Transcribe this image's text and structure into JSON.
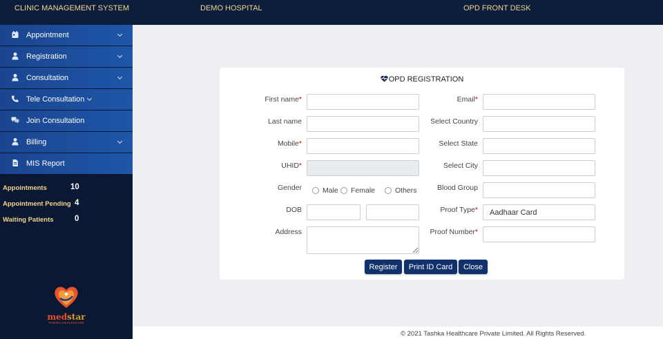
{
  "header": {
    "system_name": "CLINIC MANAGEMENT SYSTEM",
    "hospital_name": "DEMO HOSPITAL",
    "desk_name": "OPD FRONT DESK",
    "text_color": "#f5d58a",
    "background": "#0d1e3d"
  },
  "sidebar": {
    "items": [
      {
        "label": "Appointment",
        "icon": "calendar-icon",
        "has_dropdown": true
      },
      {
        "label": "Registration",
        "icon": "user-icon",
        "has_dropdown": true
      },
      {
        "label": "Consultation",
        "icon": "user-icon",
        "has_dropdown": true
      },
      {
        "label": "Tele Consultation",
        "icon": "phone-icon",
        "has_dropdown": true
      },
      {
        "label": "Join Consultation",
        "icon": "chat-icon",
        "has_dropdown": false
      },
      {
        "label": "Billing",
        "icon": "user-icon",
        "has_dropdown": true
      },
      {
        "label": "MIS Report",
        "icon": "document-icon",
        "has_dropdown": false
      }
    ],
    "stats": [
      {
        "label": "Appointments",
        "value": "10"
      },
      {
        "label": "Appointment Pending",
        "value": "4"
      },
      {
        "label": "Waiting Patients",
        "value": "0"
      }
    ],
    "logo": {
      "brand_med": "med",
      "brand_star": "star",
      "tagline": "TASHKA HEALTHCARE"
    }
  },
  "form": {
    "title": "OPD REGISTRATION",
    "title_icon": "heartbeat-icon",
    "first_name": {
      "label": "First name",
      "required": "*",
      "value": ""
    },
    "last_name": {
      "label": "Last name",
      "value": ""
    },
    "mobile": {
      "label": "Mobile",
      "required": "*",
      "value": ""
    },
    "uhid": {
      "label": "UHID",
      "required": "*",
      "value": ""
    },
    "gender": {
      "label": "Gender",
      "options": [
        "Male",
        "Female",
        "Others"
      ]
    },
    "dob": {
      "label": "DOB",
      "value_1": "",
      "value_2": ""
    },
    "address": {
      "label": "Address",
      "value": ""
    },
    "email": {
      "label": "Email",
      "required": "*",
      "value": ""
    },
    "country": {
      "label": "Select Country",
      "value": ""
    },
    "state": {
      "label": "Select State",
      "value": ""
    },
    "city": {
      "label": "Select City",
      "value": ""
    },
    "blood_group": {
      "label": "Blood Group",
      "value": ""
    },
    "proof_type": {
      "label": "Proof Type",
      "required": "*",
      "value": "Aadhaar Card"
    },
    "proof_number": {
      "label": "Proof Number",
      "required": "*",
      "value": ""
    },
    "buttons": {
      "register": "Register",
      "print_id": "Print ID Card",
      "close": "Close"
    },
    "button_color": "#10316b"
  },
  "footer": {
    "text": "© 2021 Tashka Healthcare Private Limited. All Rights Reserved."
  }
}
